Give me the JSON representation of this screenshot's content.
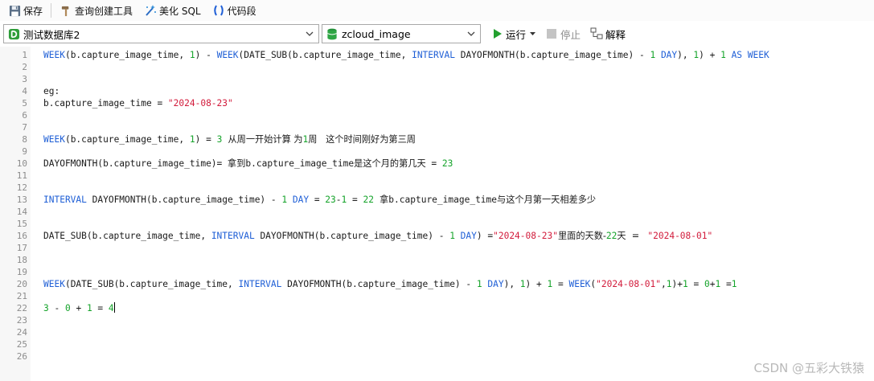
{
  "toolbar": {
    "save_label": "保存",
    "query_builder_label": "查询创建工具",
    "beautify_label": "美化 SQL",
    "snippet_label": "代码段"
  },
  "connection": {
    "name": "测试数据库2"
  },
  "database": {
    "name": "zcloud_image"
  },
  "actions": {
    "run_label": "运行",
    "stop_label": "停止",
    "explain_label": "解释"
  },
  "line_numbers": [
    "1",
    "2",
    "3",
    "4",
    "5",
    "6",
    "7",
    "8",
    "9",
    "10",
    "11",
    "12",
    "13",
    "14",
    "15",
    "16",
    "17",
    "18",
    "19",
    "20",
    "21",
    "22",
    "23",
    "24",
    "25",
    "26"
  ],
  "lines": [
    [
      [
        "k",
        "WEEK"
      ],
      [
        "",
        "(b.capture_image_time, "
      ],
      [
        "n",
        "1"
      ],
      [
        "",
        ") - "
      ],
      [
        "k",
        "WEEK"
      ],
      [
        "",
        "(DATE_SUB(b.capture_image_time, "
      ],
      [
        "k",
        "INTERVAL"
      ],
      [
        "",
        " DAYOFMONTH(b.capture_image_time) - "
      ],
      [
        "n",
        "1"
      ],
      [
        "k",
        " DAY"
      ],
      [
        "",
        "), "
      ],
      [
        "n",
        "1"
      ],
      [
        "",
        ") + "
      ],
      [
        "n",
        "1"
      ],
      [
        "k",
        " AS WEEK"
      ]
    ],
    [],
    [],
    [
      [
        "",
        "eg:"
      ]
    ],
    [
      [
        "",
        "b.capture_image_time = "
      ],
      [
        "s",
        "\"2024-08-23\""
      ]
    ],
    [],
    [],
    [
      [
        "k",
        "WEEK"
      ],
      [
        "",
        "(b.capture_image_time, "
      ],
      [
        "n",
        "1"
      ],
      [
        "",
        ") = "
      ],
      [
        "n",
        "3"
      ],
      [
        "cjk",
        "  从周一开始计算 为"
      ],
      [
        "n",
        "1"
      ],
      [
        "cjk",
        "周   这个时间刚好为第三周"
      ]
    ],
    [],
    [
      [
        "",
        "DAYOFMONTH(b.capture_image_time)= "
      ],
      [
        "cjk",
        "拿到"
      ],
      [
        "",
        "b.capture_image_time"
      ],
      [
        "cjk",
        "是这个月的第几天"
      ],
      [
        "",
        " = "
      ],
      [
        "n",
        "23"
      ]
    ],
    [],
    [],
    [
      [
        "k",
        "INTERVAL"
      ],
      [
        "",
        "",
        " "
      ],
      [
        "",
        " DAYOFMONTH(b.capture_image_time) - "
      ],
      [
        "n",
        "1"
      ],
      [
        "k",
        " DAY"
      ],
      [
        "",
        " = "
      ],
      [
        "n",
        "23"
      ],
      [
        "",
        "-"
      ],
      [
        "n",
        "1"
      ],
      [
        "",
        " = "
      ],
      [
        "n",
        "22"
      ],
      [
        "cjk",
        "  拿"
      ],
      [
        "",
        "b.capture_image_time"
      ],
      [
        "cjk",
        "与这个月第一天相差多少"
      ]
    ],
    [],
    [],
    [
      [
        "",
        "DATE_SUB(b.capture_image_time, "
      ],
      [
        "k",
        "INTERVAL"
      ],
      [
        "",
        " DAYOFMONTH(b.capture_image_time) - "
      ],
      [
        "n",
        "1"
      ],
      [
        "k",
        " DAY"
      ],
      [
        "",
        ") ="
      ],
      [
        "s",
        "\"2024-08-23\""
      ],
      [
        "cjk",
        "里面的天数-"
      ],
      [
        "n",
        "22"
      ],
      [
        "cjk",
        "天  = "
      ],
      [
        "",
        " "
      ],
      [
        "s",
        "\"2024-08-01\""
      ]
    ],
    [],
    [],
    [],
    [
      [
        "k",
        "WEEK"
      ],
      [
        "",
        "(DATE_SUB(b.capture_image_time, "
      ],
      [
        "k",
        "INTERVAL"
      ],
      [
        "",
        " DAYOFMONTH(b.capture_image_time) - "
      ],
      [
        "n",
        "1"
      ],
      [
        "k",
        " DAY"
      ],
      [
        "",
        "), "
      ],
      [
        "n",
        "1"
      ],
      [
        "",
        ") + "
      ],
      [
        "n",
        "1"
      ],
      [
        "",
        " = "
      ],
      [
        "k",
        "WEEK"
      ],
      [
        "",
        "("
      ],
      [
        "s",
        "\"2024-08-01\""
      ],
      [
        "",
        ","
      ],
      [
        "n",
        "1"
      ],
      [
        "",
        ")+"
      ],
      [
        "n",
        "1"
      ],
      [
        "",
        " = "
      ],
      [
        "n",
        "0"
      ],
      [
        "",
        "+"
      ],
      [
        "n",
        "1"
      ],
      [
        "",
        " ="
      ],
      [
        "n",
        "1"
      ]
    ],
    [],
    [
      [
        "n",
        "3"
      ],
      [
        "",
        " - "
      ],
      [
        "n",
        "0"
      ],
      [
        "",
        " + "
      ],
      [
        "n",
        "1"
      ],
      [
        "",
        " = "
      ],
      [
        "n",
        "4"
      ]
    ],
    [],
    [],
    [],
    []
  ],
  "watermark": "CSDN @五彩大铁猿"
}
